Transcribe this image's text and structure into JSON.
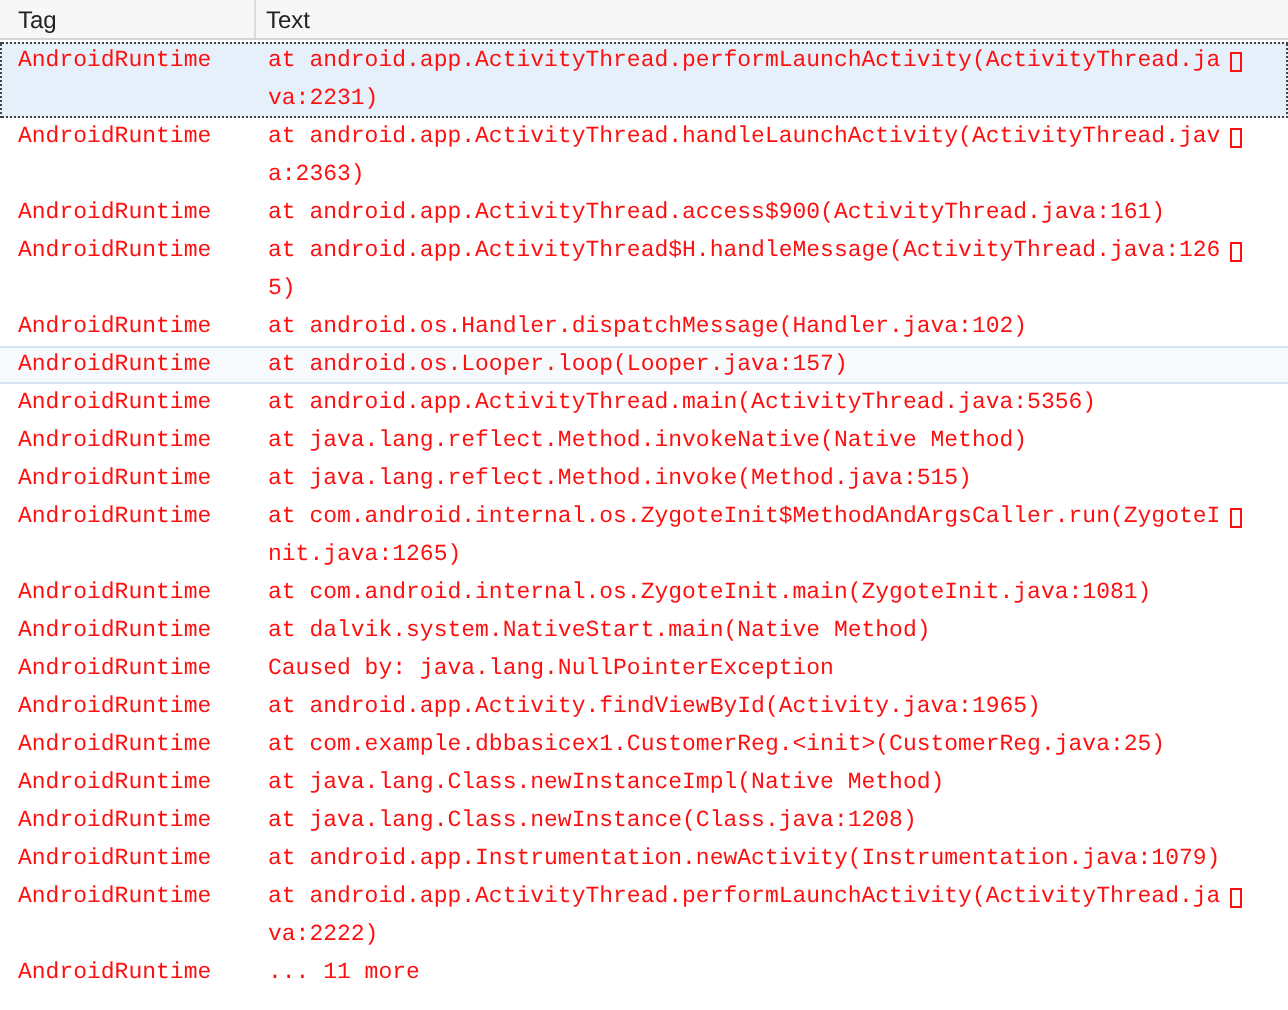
{
  "columns": [
    "Tag",
    "Text"
  ],
  "rows": [
    {
      "tag": "AndroidRuntime",
      "lines": [
        "at android.app.ActivityThread.performLaunchActivity(ActivityThread.ja",
        "va:2231)"
      ],
      "wrapped": true,
      "selected": true,
      "hovered": false
    },
    {
      "tag": "AndroidRuntime",
      "lines": [
        "at android.app.ActivityThread.handleLaunchActivity(ActivityThread.jav",
        "a:2363)"
      ],
      "wrapped": true,
      "selected": false,
      "hovered": false
    },
    {
      "tag": "AndroidRuntime",
      "lines": [
        "at android.app.ActivityThread.access$900(ActivityThread.java:161)"
      ],
      "wrapped": false,
      "selected": false,
      "hovered": false
    },
    {
      "tag": "AndroidRuntime",
      "lines": [
        "at android.app.ActivityThread$H.handleMessage(ActivityThread.java:126",
        "5)"
      ],
      "wrapped": true,
      "selected": false,
      "hovered": false
    },
    {
      "tag": "AndroidRuntime",
      "lines": [
        "at android.os.Handler.dispatchMessage(Handler.java:102)"
      ],
      "wrapped": false,
      "selected": false,
      "hovered": false
    },
    {
      "tag": "AndroidRuntime",
      "lines": [
        "at android.os.Looper.loop(Looper.java:157)"
      ],
      "wrapped": false,
      "selected": false,
      "hovered": true
    },
    {
      "tag": "AndroidRuntime",
      "lines": [
        "at android.app.ActivityThread.main(ActivityThread.java:5356)"
      ],
      "wrapped": false,
      "selected": false,
      "hovered": false
    },
    {
      "tag": "AndroidRuntime",
      "lines": [
        "at java.lang.reflect.Method.invokeNative(Native Method)"
      ],
      "wrapped": false,
      "selected": false,
      "hovered": false
    },
    {
      "tag": "AndroidRuntime",
      "lines": [
        "at java.lang.reflect.Method.invoke(Method.java:515)"
      ],
      "wrapped": false,
      "selected": false,
      "hovered": false
    },
    {
      "tag": "AndroidRuntime",
      "lines": [
        "at com.android.internal.os.ZygoteInit$MethodAndArgsCaller.run(ZygoteI",
        "nit.java:1265)"
      ],
      "wrapped": true,
      "selected": false,
      "hovered": false
    },
    {
      "tag": "AndroidRuntime",
      "lines": [
        "at com.android.internal.os.ZygoteInit.main(ZygoteInit.java:1081)"
      ],
      "wrapped": false,
      "selected": false,
      "hovered": false
    },
    {
      "tag": "AndroidRuntime",
      "lines": [
        "at dalvik.system.NativeStart.main(Native Method)"
      ],
      "wrapped": false,
      "selected": false,
      "hovered": false
    },
    {
      "tag": "AndroidRuntime",
      "lines": [
        "Caused by: java.lang.NullPointerException"
      ],
      "wrapped": false,
      "selected": false,
      "hovered": false
    },
    {
      "tag": "AndroidRuntime",
      "lines": [
        "at android.app.Activity.findViewById(Activity.java:1965)"
      ],
      "wrapped": false,
      "selected": false,
      "hovered": false
    },
    {
      "tag": "AndroidRuntime",
      "lines": [
        "at com.example.dbbasicex1.CustomerReg.<init>(CustomerReg.java:25)"
      ],
      "wrapped": false,
      "selected": false,
      "hovered": false
    },
    {
      "tag": "AndroidRuntime",
      "lines": [
        "at java.lang.Class.newInstanceImpl(Native Method)"
      ],
      "wrapped": false,
      "selected": false,
      "hovered": false
    },
    {
      "tag": "AndroidRuntime",
      "lines": [
        "at java.lang.Class.newInstance(Class.java:1208)"
      ],
      "wrapped": false,
      "selected": false,
      "hovered": false
    },
    {
      "tag": "AndroidRuntime",
      "lines": [
        "at android.app.Instrumentation.newActivity(Instrumentation.java:1079)"
      ],
      "wrapped": false,
      "selected": false,
      "hovered": false
    },
    {
      "tag": "AndroidRuntime",
      "lines": [
        "at android.app.ActivityThread.performLaunchActivity(ActivityThread.ja",
        "va:2222)"
      ],
      "wrapped": true,
      "selected": false,
      "hovered": false
    },
    {
      "tag": "AndroidRuntime",
      "lines": [
        "... 11 more"
      ],
      "wrapped": false,
      "selected": false,
      "hovered": false
    }
  ]
}
